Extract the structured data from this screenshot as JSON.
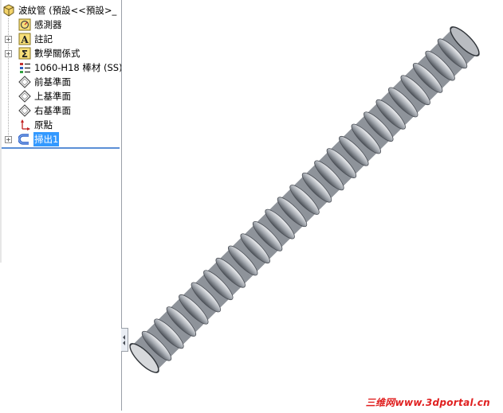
{
  "feature_tree": {
    "root": {
      "label": "波紋管 (預設<<預設>_",
      "icon": "part-icon"
    },
    "items": [
      {
        "label": "感測器",
        "icon": "sensor-icon",
        "expandable": false
      },
      {
        "label": "註記",
        "icon": "annotation-icon",
        "expandable": true
      },
      {
        "label": "數學關係式",
        "icon": "equation-icon",
        "expandable": true
      },
      {
        "label": "1060-H18 棒材 (SS)",
        "icon": "material-icon",
        "expandable": false
      },
      {
        "label": "前基準面",
        "icon": "plane-icon",
        "expandable": false
      },
      {
        "label": "上基準面",
        "icon": "plane-icon",
        "expandable": false
      },
      {
        "label": "右基準面",
        "icon": "plane-icon",
        "expandable": false
      },
      {
        "label": "原點",
        "icon": "origin-icon",
        "expandable": false
      },
      {
        "label": "掃出1",
        "icon": "sweep-icon",
        "expandable": true,
        "selected": true
      }
    ]
  },
  "viewport": {
    "model": "corrugated-tube",
    "model_color": "#8e939a"
  },
  "watermark": "三维网www.3dportal.cn",
  "colors": {
    "selection": "#3399ff",
    "accent": "#5b8fd6",
    "watermark": "#e02020"
  }
}
